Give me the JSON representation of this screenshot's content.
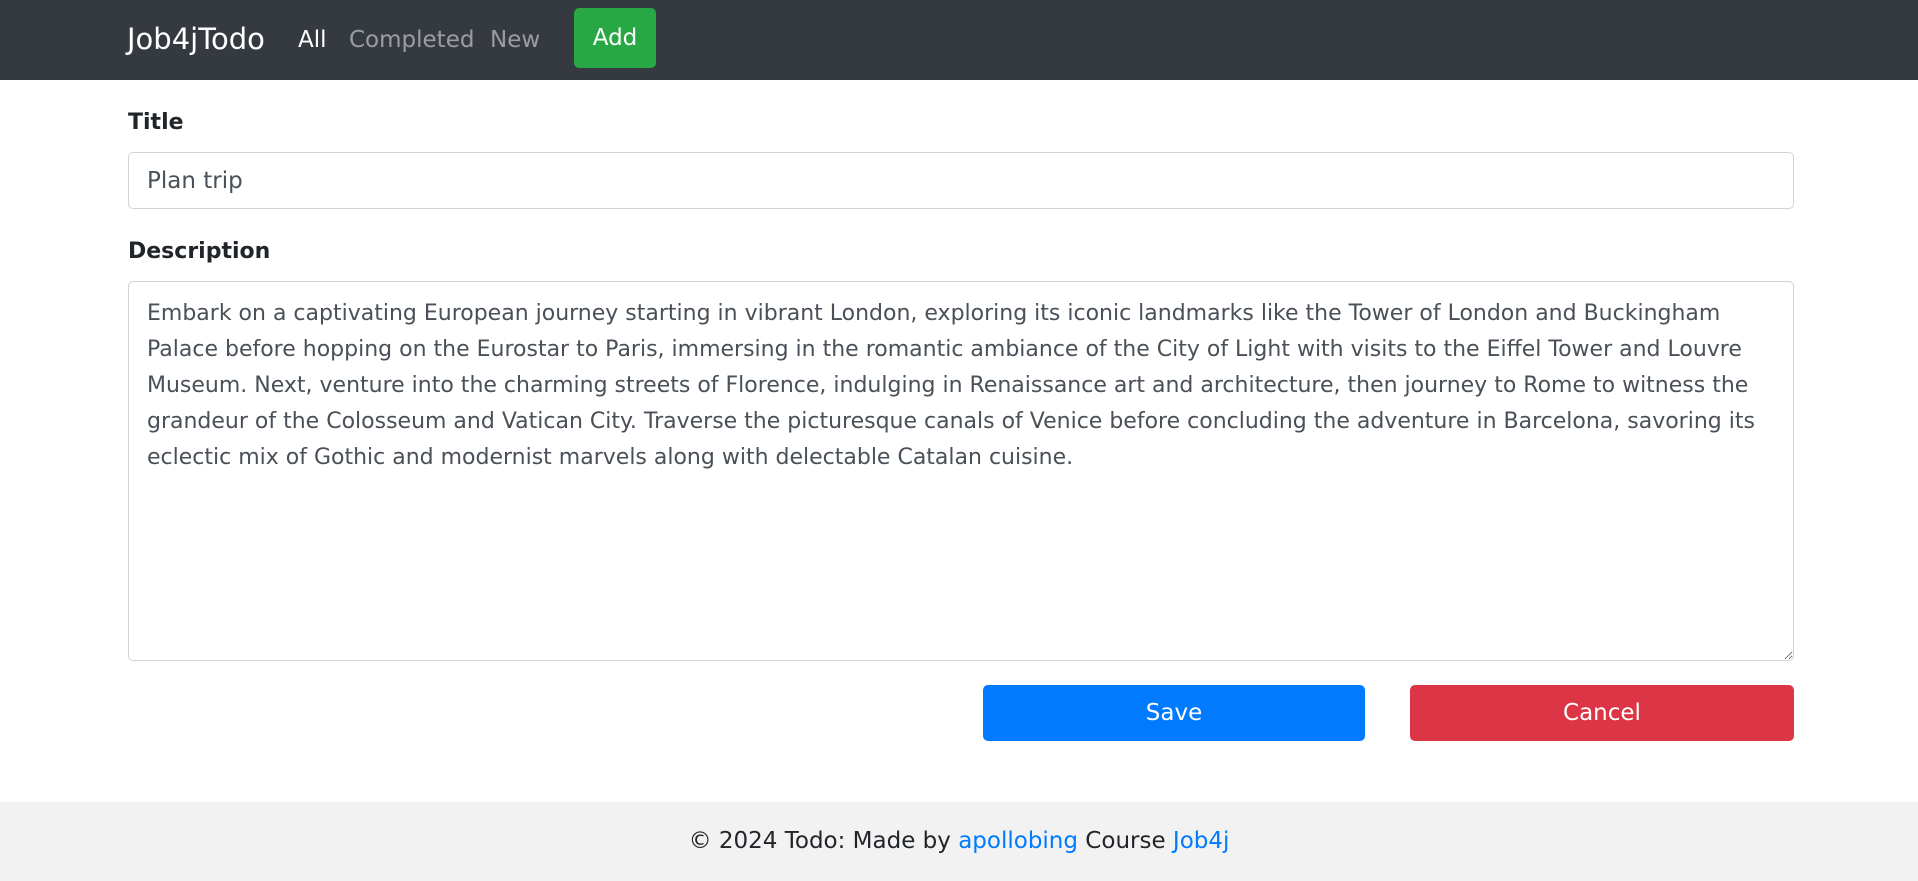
{
  "navbar": {
    "brand": "Job4jTodo",
    "links": [
      {
        "label": "All",
        "active": true
      },
      {
        "label": "Completed",
        "active": false
      },
      {
        "label": "New",
        "active": false
      }
    ],
    "add_label": "Add"
  },
  "form": {
    "title_label": "Title",
    "title_value": "Plan trip",
    "description_label": "Description",
    "description_value": "Embark on a captivating European journey starting in vibrant London, exploring its iconic landmarks like the Tower of London and Buckingham Palace before hopping on the Eurostar to Paris, immersing in the romantic ambiance of the City of Light with visits to the Eiffel Tower and Louvre Museum. Next, venture into the charming streets of Florence, indulging in Renaissance art and architecture, then journey to Rome to witness the grandeur of the Colosseum and Vatican City. Traverse the picturesque canals of Venice before concluding the adventure in Barcelona, savoring its eclectic mix of Gothic and modernist marvels along with delectable Catalan cuisine.",
    "save_label": "Save",
    "cancel_label": "Cancel"
  },
  "footer": {
    "prefix": "© 2024 Todo: Made by ",
    "author_link": "apollobing",
    "middle": " Course ",
    "course_link": "Job4j"
  },
  "colors": {
    "navbar_bg": "#343a40",
    "add_button": "#28a745",
    "save_button": "#007bff",
    "cancel_button": "#dc3545",
    "link": "#007bff",
    "footer_bg": "#f2f2f2"
  }
}
